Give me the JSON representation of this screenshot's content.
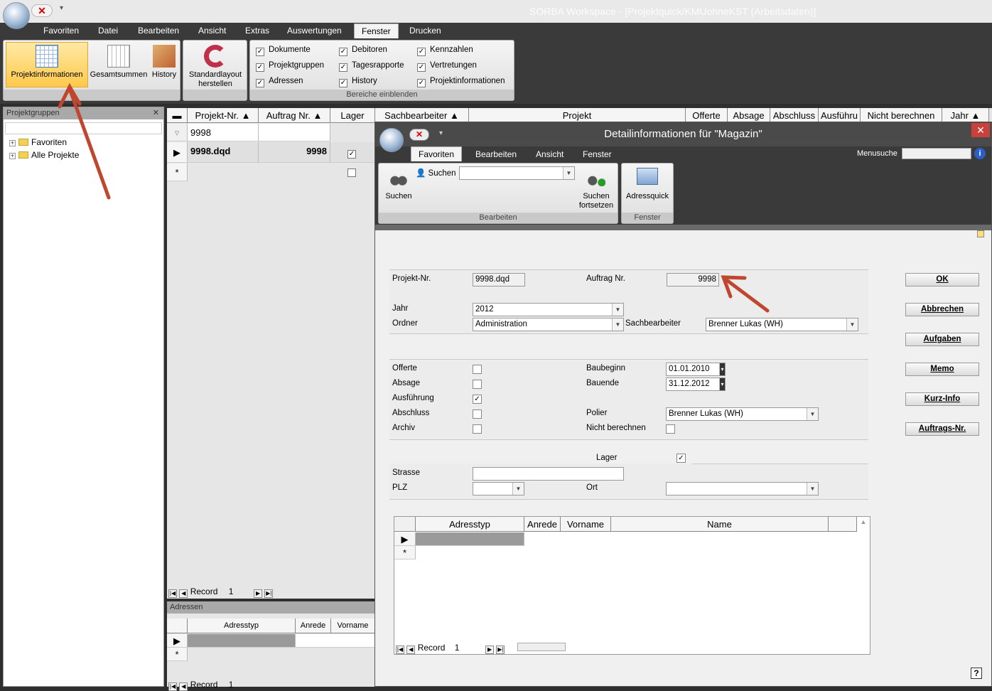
{
  "window": {
    "title": "SORBA Workspace - [Projektquick/KMUohneKST (Arbeitsdaten)]"
  },
  "ribbon": {
    "tabs": [
      "Favoriten",
      "Datei",
      "Bearbeiten",
      "Ansicht",
      "Extras",
      "Auswertungen",
      "Fenster",
      "Drucken"
    ],
    "active_tab": "Fenster",
    "buttons": {
      "projektinformationen": "Projektinformationen",
      "gesamtsummen": "Gesamtsummen",
      "history": "History",
      "standardlayout": "Standardlayout herstellen"
    },
    "checks_col1": [
      "Dokumente",
      "Projektgruppen",
      "Adressen"
    ],
    "checks_col2": [
      "Debitoren",
      "Tagesrapporte",
      "History"
    ],
    "checks_col3": [
      "Kennzahlen",
      "Vertretungen",
      "Projektinformationen"
    ],
    "group_caption": "Bereiche einblenden"
  },
  "left_panel": {
    "title": "Projektgruppen",
    "close": "✕",
    "items": [
      "Favoriten",
      "Alle Projekte"
    ]
  },
  "grid": {
    "headers": [
      "Projekt-Nr.",
      "Auftrag Nr.",
      "Lager",
      "Sachbearbeiter",
      "Projekt",
      "Offerte",
      "Absage",
      "Abschluss",
      "Ausführu",
      "Nicht berechnen",
      "Jahr"
    ],
    "filter_value": "9998",
    "row": {
      "projekt_nr": "9998.dqd",
      "auftrag_nr": "9998",
      "lager": true
    },
    "new_row_marker": "*",
    "record_label": "Record",
    "record_value": "1"
  },
  "adressen_panel": {
    "title": "Adressen",
    "headers": [
      "Adresstyp",
      "Anrede",
      "Vorname"
    ],
    "record_label": "Record",
    "record_value": "1"
  },
  "dialog": {
    "title": "Detailinformationen für \"Magazin\"",
    "tabs": [
      "Favoriten",
      "Bearbeiten",
      "Ansicht",
      "Fenster"
    ],
    "active_tab": "Favoriten",
    "menusuche_label": "Menusuche",
    "buttons": {
      "suchen_small": "Suchen",
      "suchen": "Suchen",
      "suchen_fortsetzen": "Suchen fortsetzen",
      "adressquick": "Adressquick"
    },
    "group_bearbeiten": "Bearbeiten",
    "group_fenster": "Fenster",
    "form": {
      "projekt_nr_label": "Projekt-Nr.",
      "projekt_nr": "9998.dqd",
      "auftrag_nr_label": "Auftrag Nr.",
      "auftrag_nr": "9998",
      "jahr_label": "Jahr",
      "jahr": "2012",
      "ordner_label": "Ordner",
      "ordner": "Administration",
      "sachbearbeiter_label": "Sachbearbeiter",
      "sachbearbeiter": "Brenner Lukas (WH)",
      "offerte_label": "Offerte",
      "offerte": false,
      "absage_label": "Absage",
      "absage": false,
      "ausfuehrung_label": "Ausführung",
      "ausfuehrung": true,
      "abschluss_label": "Abschluss",
      "abschluss": false,
      "archiv_label": "Archiv",
      "archiv": false,
      "baubeginn_label": "Baubeginn",
      "baubeginn": "01.01.2010",
      "bauende_label": "Bauende",
      "bauende": "31.12.2012",
      "polier_label": "Polier",
      "polier": "Brenner Lukas (WH)",
      "nicht_berechnen_label": "Nicht berechnen",
      "nicht_berechnen": false,
      "lager_label": "Lager",
      "lager": true,
      "strasse_label": "Strasse",
      "strasse": "",
      "plz_label": "PLZ",
      "plz": "",
      "ort_label": "Ort",
      "ort": ""
    },
    "side_buttons": [
      "OK",
      "Abbrechen",
      "Aufgaben",
      "Memo",
      "Kurz-Info",
      "Auftrags-Nr."
    ],
    "addr_grid": {
      "headers": [
        "Adresstyp",
        "Anrede",
        "Vorname",
        "Name"
      ],
      "record_label": "Record",
      "record_value": "1"
    },
    "help": "?"
  },
  "colors": {
    "annotation_arrow": "#c0472f",
    "ribbon_dark": "#3a3a3a",
    "selected_button": "#ffc94a"
  }
}
